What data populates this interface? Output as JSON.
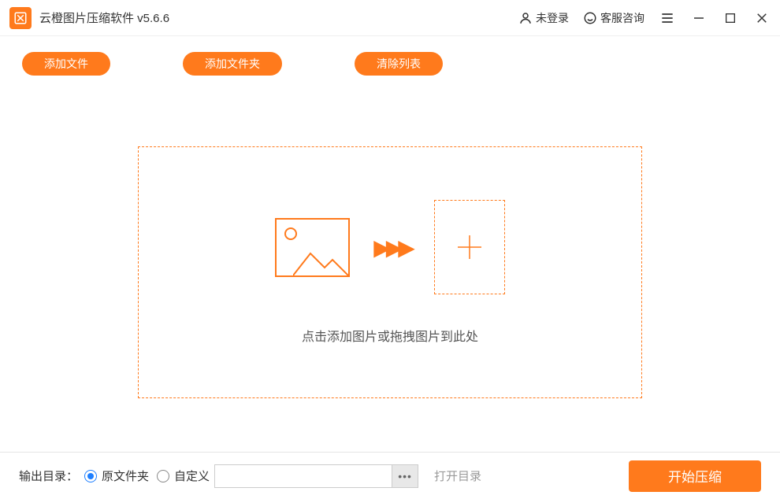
{
  "titlebar": {
    "app_title": "云橙图片压缩软件 v5.6.6",
    "login_status": "未登录",
    "support": "客服咨询"
  },
  "toolbar": {
    "add_file": "添加文件",
    "add_folder": "添加文件夹",
    "clear_list": "清除列表"
  },
  "dropzone": {
    "hint": "点击添加图片或拖拽图片到此处"
  },
  "footer": {
    "output_label": "输出目录：",
    "radio_original": "原文件夹",
    "radio_custom": "自定义",
    "path_value": "",
    "browse_dots": "•••",
    "open_dir": "打开目录",
    "start_button": "开始压缩",
    "selected": "original"
  }
}
